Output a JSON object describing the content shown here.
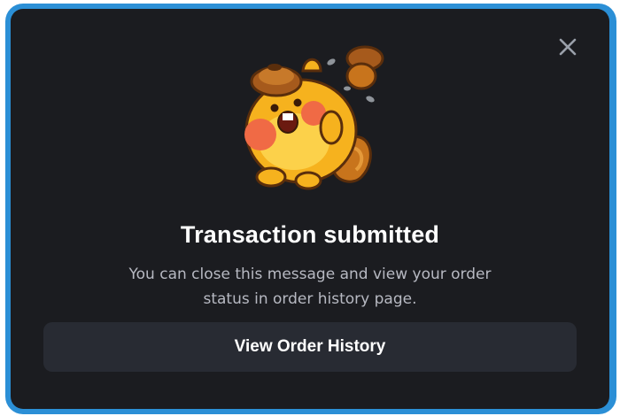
{
  "dialog": {
    "title": "Transaction submitted",
    "message": "You can close this message and view your order status in order history page.",
    "primary_button_label": "View Order History",
    "close_icon": "close-icon",
    "illustration": "squirrel-mascot-illustration"
  },
  "colors": {
    "frame_border": "#2b8fd6",
    "modal_background": "#1b1c20",
    "button_background": "#282b33",
    "title_text": "#ffffff",
    "message_text": "#b7b9c2",
    "close_icon": "#9aa0aa"
  }
}
